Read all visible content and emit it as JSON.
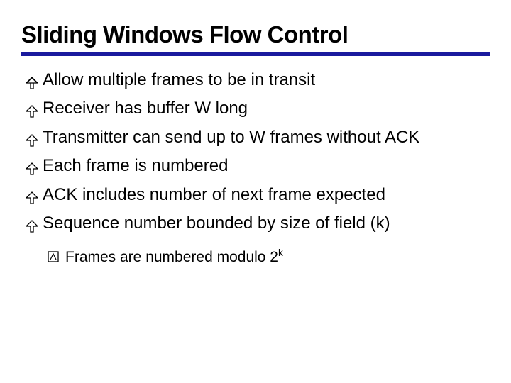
{
  "title": "Sliding Windows Flow Control",
  "bullets": [
    "Allow multiple frames to be in transit",
    "Receiver has buffer W long",
    "Transmitter can send up to W frames without ACK",
    "Each frame is numbered",
    "ACK includes number of next frame expected",
    "Sequence number bounded by size of field (k)"
  ],
  "sub": {
    "prefix": "Frames are numbered modulo 2",
    "exp": "k"
  }
}
